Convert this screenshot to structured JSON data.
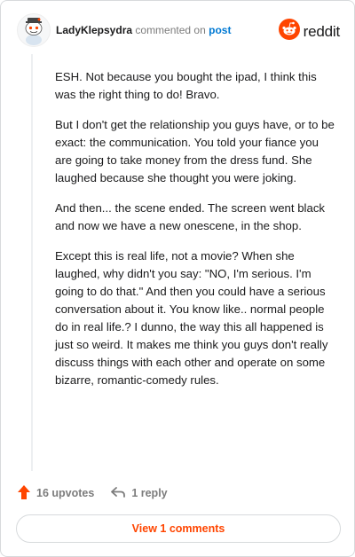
{
  "header": {
    "username": "LadyKlepsydra",
    "commented_text": "commented on",
    "post_link": "post",
    "brand": "reddit"
  },
  "comment": {
    "paragraphs": [
      "ESH. Not because you bought the ipad, I think this was the right thing to do! Bravo.",
      "But I don't get the relationship you guys have, or to be exact: the communication. You told your fiance you are going to take money from the dress fund. She laughed because she thought you were joking.",
      "And then... the scene ended. The screen went black and now we have a new onescene, in the shop.",
      "Except this is real life, not a movie? When she laughed, why didn't you say: \"NO, I'm serious. I'm going to do that.\" And then you could have a serious conversation about it. You know like.. normal people do in real life.? I dunno, the way this all happened is just so weird. It makes me think you guys don't really discuss things with each other and operate on some bizarre, romantic-comedy rules."
    ]
  },
  "actions": {
    "upvotes": "16 upvotes",
    "replies": "1 reply"
  },
  "footer": {
    "view_comments": "View 1 comments"
  },
  "colors": {
    "accent": "#ff4500",
    "link": "#0079d3",
    "muted": "#7c7c7c"
  },
  "icons": [
    "snoo-avatar-icon",
    "reddit-logo-icon",
    "upvote-arrow-icon",
    "reply-arrow-icon"
  ]
}
